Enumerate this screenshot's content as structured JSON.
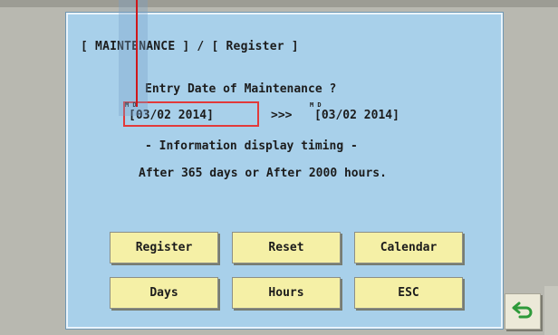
{
  "dialog": {
    "title": "[ MAINTENANCE ] / [ Register ]",
    "question": "Entry Date of Maintenance ?",
    "date_mark_left": "M D",
    "current_date": "[03/02 2014]",
    "arrows": ">>>",
    "date_mark_right": "M D",
    "new_date": "[03/02 2014]",
    "info_title": "- Information display timing -",
    "info_text": "After 365 days or After 2000 hours."
  },
  "buttons": {
    "register": "Register",
    "reset": "Reset",
    "calendar": "Calendar",
    "days": "Days",
    "hours": "Hours",
    "esc": "ESC"
  },
  "icons": {
    "back": "return-arrow-icon"
  },
  "colors": {
    "dialog_bg": "#a8d0ea",
    "button_bg": "#f5f0a6",
    "highlight": "#e23a3a",
    "back_arrow": "#2e9a3a"
  }
}
